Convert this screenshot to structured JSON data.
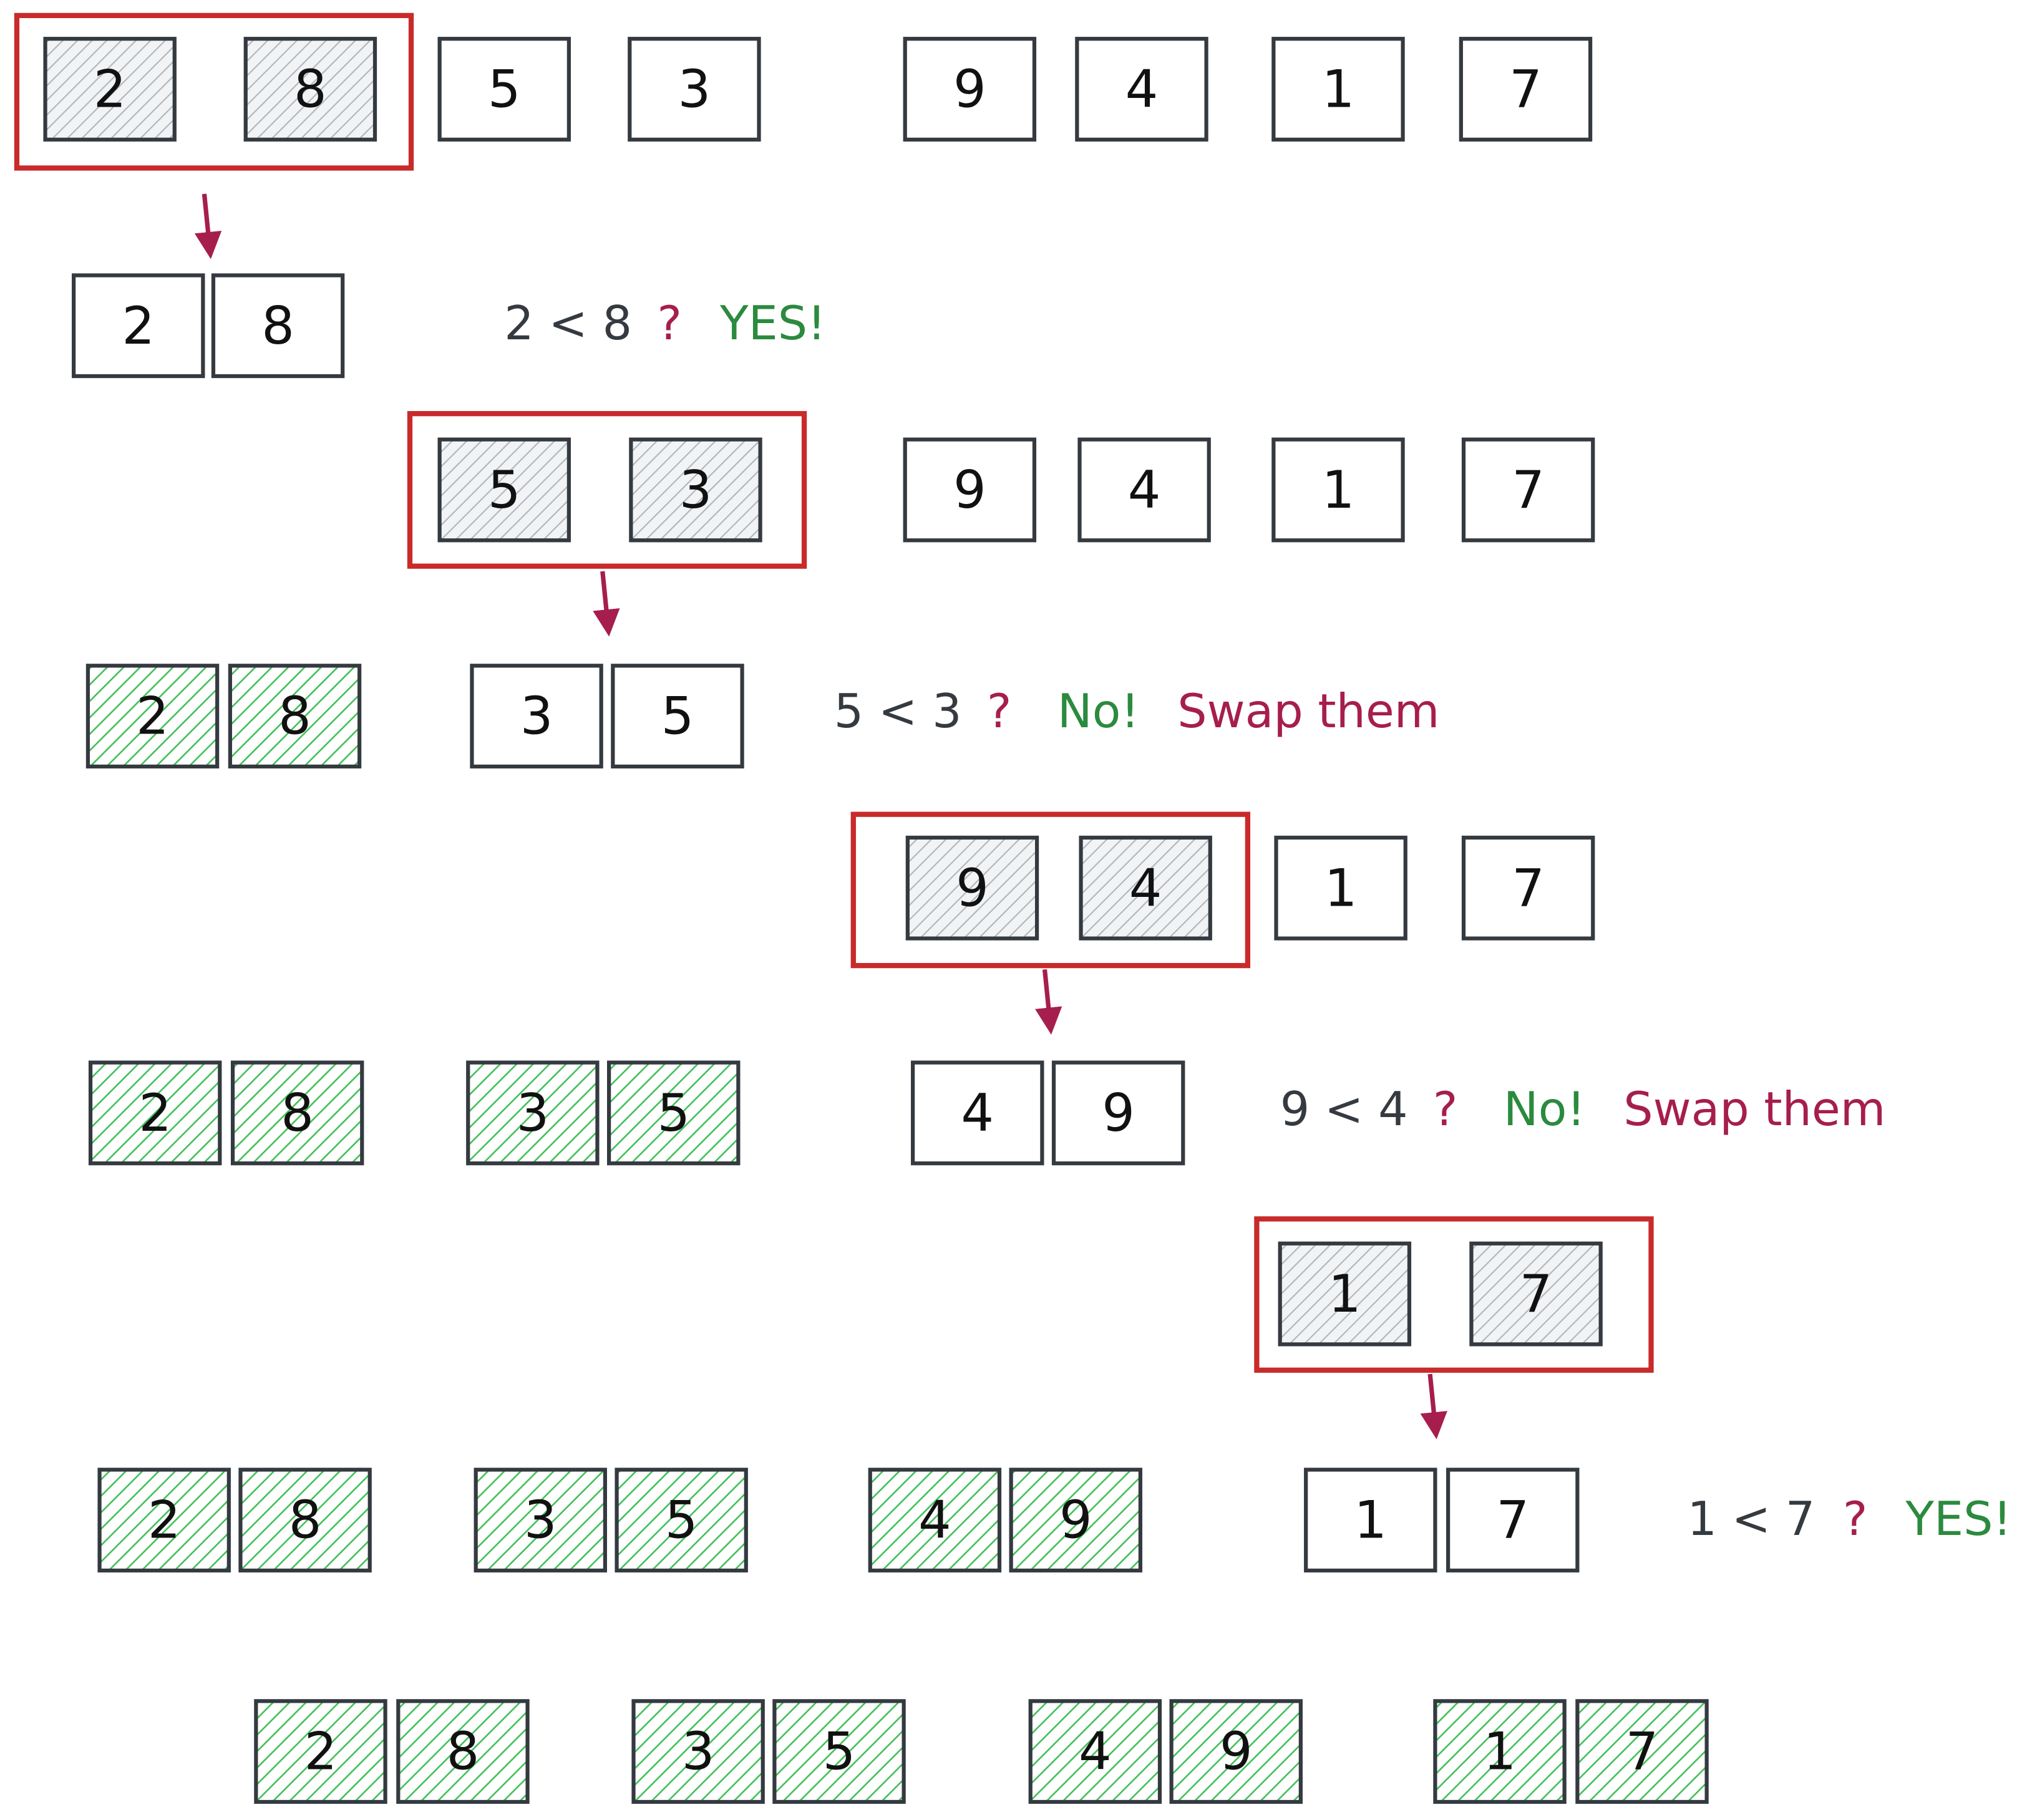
{
  "colors": {
    "stroke": "#343a40",
    "highlight": "#c92a2a",
    "arrow": "#a61e4d",
    "sorted_fill": "#40c057",
    "compare_fill": "#ced4da",
    "yes": "#2b8a3e",
    "swap": "#a61e4d"
  },
  "rows": [
    {
      "cells": [
        {
          "v": "2",
          "s": "compare"
        },
        {
          "v": "8",
          "s": "compare"
        },
        {
          "v": "5",
          "s": "plain"
        },
        {
          "v": "3",
          "s": "plain"
        },
        {
          "v": "9",
          "s": "plain"
        },
        {
          "v": "4",
          "s": "plain"
        },
        {
          "v": "1",
          "s": "plain"
        },
        {
          "v": "7",
          "s": "plain"
        }
      ]
    },
    {
      "cells": [
        {
          "v": "2",
          "s": "plain"
        },
        {
          "v": "8",
          "s": "plain"
        }
      ]
    },
    {
      "cells": [
        {
          "v": "5",
          "s": "compare"
        },
        {
          "v": "3",
          "s": "compare"
        },
        {
          "v": "9",
          "s": "plain"
        },
        {
          "v": "4",
          "s": "plain"
        },
        {
          "v": "1",
          "s": "plain"
        },
        {
          "v": "7",
          "s": "plain"
        }
      ]
    },
    {
      "cells": [
        {
          "v": "2",
          "s": "sorted"
        },
        {
          "v": "8",
          "s": "sorted"
        },
        {
          "v": "3",
          "s": "plain"
        },
        {
          "v": "5",
          "s": "plain"
        }
      ]
    },
    {
      "cells": [
        {
          "v": "9",
          "s": "compare"
        },
        {
          "v": "4",
          "s": "compare"
        },
        {
          "v": "1",
          "s": "plain"
        },
        {
          "v": "7",
          "s": "plain"
        }
      ]
    },
    {
      "cells": [
        {
          "v": "2",
          "s": "sorted"
        },
        {
          "v": "8",
          "s": "sorted"
        },
        {
          "v": "3",
          "s": "sorted"
        },
        {
          "v": "5",
          "s": "sorted"
        },
        {
          "v": "4",
          "s": "plain"
        },
        {
          "v": "9",
          "s": "plain"
        }
      ]
    },
    {
      "cells": [
        {
          "v": "1",
          "s": "compare"
        },
        {
          "v": "7",
          "s": "compare"
        }
      ]
    },
    {
      "cells": [
        {
          "v": "2",
          "s": "sorted"
        },
        {
          "v": "8",
          "s": "sorted"
        },
        {
          "v": "3",
          "s": "sorted"
        },
        {
          "v": "5",
          "s": "sorted"
        },
        {
          "v": "4",
          "s": "sorted"
        },
        {
          "v": "9",
          "s": "sorted"
        },
        {
          "v": "1",
          "s": "plain"
        },
        {
          "v": "7",
          "s": "plain"
        }
      ]
    },
    {
      "cells": [
        {
          "v": "2",
          "s": "sorted"
        },
        {
          "v": "8",
          "s": "sorted"
        },
        {
          "v": "3",
          "s": "sorted"
        },
        {
          "v": "5",
          "s": "sorted"
        },
        {
          "v": "4",
          "s": "sorted"
        },
        {
          "v": "9",
          "s": "sorted"
        },
        {
          "v": "1",
          "s": "sorted"
        },
        {
          "v": "7",
          "s": "sorted"
        }
      ]
    }
  ],
  "comparisons": [
    {
      "question": "2 < 8",
      "mark": "?",
      "answer": "YES!",
      "action": ""
    },
    {
      "question": "5 < 3",
      "mark": "?",
      "answer": "No!",
      "action": "Swap them"
    },
    {
      "question": "9 < 4",
      "mark": "?",
      "answer": "No!",
      "action": "Swap them"
    },
    {
      "question": "1 < 7",
      "mark": "?",
      "answer": "YES!",
      "action": ""
    }
  ]
}
